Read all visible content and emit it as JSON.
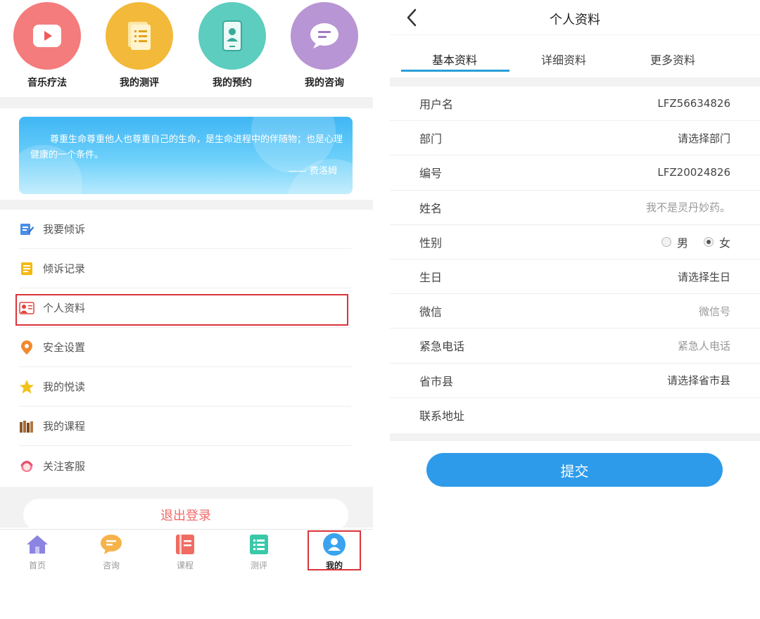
{
  "left": {
    "top_icons": [
      {
        "label": "音乐疗法",
        "icon": "play-icon",
        "color": "#f47c7c"
      },
      {
        "label": "我的测评",
        "icon": "document-icon",
        "color": "#f3b93a"
      },
      {
        "label": "我的预约",
        "icon": "phone-profile-icon",
        "color": "#5ccdbf"
      },
      {
        "label": "我的咨询",
        "icon": "chat-bubble-icon",
        "color": "#b895d4"
      }
    ],
    "banner": {
      "quote": "尊重生命尊重他人也尊重自己的生命，是生命进程中的伴随物；也是心理健康的一个条件。",
      "author": "—— 费洛姆"
    },
    "menu": [
      {
        "label": "我要倾诉",
        "icon": "edit-note-icon"
      },
      {
        "label": "倾诉记录",
        "icon": "record-list-icon"
      },
      {
        "label": "个人资料",
        "icon": "profile-card-icon"
      },
      {
        "label": "安全设置",
        "icon": "location-pin-icon"
      },
      {
        "label": "我的悦读",
        "icon": "star-icon"
      },
      {
        "label": "我的课程",
        "icon": "books-icon"
      },
      {
        "label": "关注客服",
        "icon": "customer-service-icon"
      }
    ],
    "logout_label": "退出登录",
    "tabbar": [
      {
        "label": "首页",
        "icon": "home-icon"
      },
      {
        "label": "咨询",
        "icon": "chat-icon"
      },
      {
        "label": "课程",
        "icon": "course-book-icon"
      },
      {
        "label": "测评",
        "icon": "test-list-icon"
      },
      {
        "label": "我的",
        "icon": "user-icon"
      }
    ]
  },
  "right": {
    "title": "个人资料",
    "tabs": [
      "基本资料",
      "详细资料",
      "更多资料"
    ],
    "fields": [
      {
        "label": "用户名",
        "value": "LFZ56634826"
      },
      {
        "label": "部门",
        "value": "请选择部门"
      },
      {
        "label": "编号",
        "value": "LFZ20024826"
      },
      {
        "label": "姓名",
        "value": "我不是灵丹妙药。"
      },
      {
        "label": "性别",
        "value": ""
      },
      {
        "label": "生日",
        "value": "请选择生日"
      },
      {
        "label": "微信",
        "value": "微信号"
      },
      {
        "label": "紧急电话",
        "value": "紧急人电话"
      },
      {
        "label": "省市县",
        "value": "请选择省市县"
      },
      {
        "label": "联系地址",
        "value": ""
      }
    ],
    "gender_options": [
      "男",
      "女"
    ],
    "gender_selected": "女",
    "submit_label": "提交"
  },
  "colors": {
    "accent_blue": "#2e9bea",
    "highlight_red": "#d9343a",
    "logout_red": "#f06a6a"
  }
}
